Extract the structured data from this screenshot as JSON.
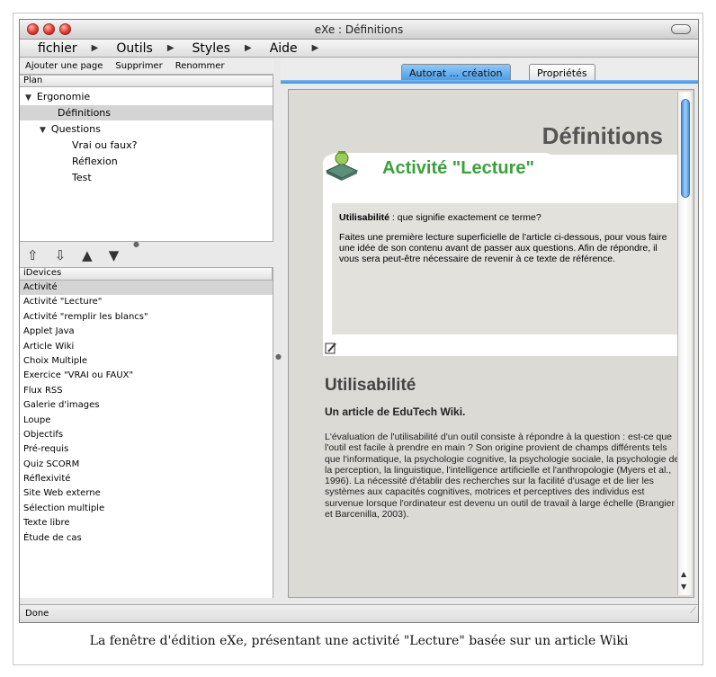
{
  "window": {
    "title": "eXe : Définitions"
  },
  "menu": [
    {
      "label": "fichier"
    },
    {
      "label": "Outils"
    },
    {
      "label": "Styles"
    },
    {
      "label": "Aide"
    }
  ],
  "toolbar": {
    "add_page": "Ajouter une page",
    "delete": "Supprimer",
    "rename": "Renommer"
  },
  "outline": {
    "header": "Plan",
    "nodes": [
      {
        "label": "Ergonomie"
      },
      {
        "label": "Définitions"
      },
      {
        "label": "Questions"
      },
      {
        "label": "Vrai ou faux?"
      },
      {
        "label": "Réflexion"
      },
      {
        "label": "Test"
      }
    ],
    "selected": "Définitions"
  },
  "idevices": {
    "header": "iDevices",
    "items": [
      "Activité",
      "Activité \"Lecture\"",
      "Activité \"remplir les blancs\"",
      "Applet Java",
      "Article Wiki",
      "Choix Multiple",
      "Exercice \"VRAI ou FAUX\"",
      "Flux RSS",
      "Galerie d'images",
      "Loupe",
      "Objectifs",
      "Pré-requis",
      "Quiz SCORM",
      "Réflexivité",
      "Site Web externe",
      "Sélection multiple",
      "Texte libre",
      "Étude de cas"
    ],
    "selected": "Activité"
  },
  "tabs": {
    "authoring": "Autorat ... création",
    "properties": "Propriétés"
  },
  "content": {
    "page_title": "Définitions",
    "activity_title": "Activité \"Lecture\"",
    "term": "Utilisabilité",
    "question_rest": " : que signifie exactement ce terme?",
    "instructions": "Faites une première lecture superficielle de l'article ci-dessous, pour vous faire une idée de son contenu avant de passer aux questions. Afin de répondre, il vous sera peut-être nécessaire de revenir à ce texte de référence.",
    "article_heading": "Utilisabilité",
    "article_source": "Un article de EduTech Wiki.",
    "article_body": "L'évaluation de l'utilisabilité d'un outil consiste à répondre à la question : est-ce que l'outil est facile à prendre en main ? Son origine provient de champs différents tels que l'informatique, la psychologie cognitive, la psychologie sociale, la psychologie de la perception, la linguistique, l'intelligence artificielle et l'anthropologie (Myers et al., 1996). La nécessité d'établir des recherches sur la facilité d'usage et de lier les systèmes aux capacités cognitives, motrices et perceptives des individus est survenue lorsque l'ordinateur est devenu un outil de travail à large échelle (Brangier et Barcenilla, 2003)."
  },
  "status": {
    "text": "Done"
  },
  "caption": "La fenêtre d'édition eXe, présentant une activité \"Lecture\" basée sur un article Wiki",
  "colors": {
    "accent": "#3d94e3",
    "activity_title": "#3aa23c",
    "selection": "#d4d4d4"
  }
}
